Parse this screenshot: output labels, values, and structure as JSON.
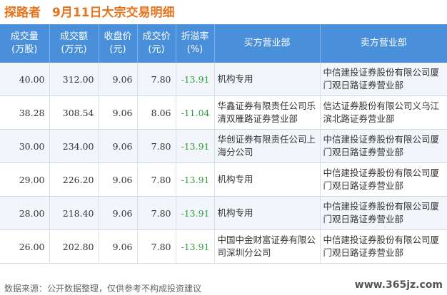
{
  "header": {
    "stock_name": "探路者",
    "title": "9月11日大宗交易明细"
  },
  "table": {
    "columns": [
      {
        "line1": "成交量",
        "line2": "(万股)"
      },
      {
        "line1": "成交额",
        "line2": "(万元)"
      },
      {
        "line1": "收盘价",
        "line2": "(元)"
      },
      {
        "line1": "成交价",
        "line2": "(元)"
      },
      {
        "line1": "折溢率",
        "line2": "(%)"
      },
      {
        "line1": "买方营业部",
        "line2": ""
      },
      {
        "line1": "卖方营业部",
        "line2": ""
      }
    ],
    "rows": [
      {
        "volume": "40.00",
        "amount": "312.00",
        "close": "9.06",
        "price": "7.80",
        "premium": "-13.91",
        "buyer": "机构专用",
        "seller": "中信建投证券股份有限公司厦门观日路证券营业部"
      },
      {
        "volume": "38.28",
        "amount": "308.54",
        "close": "9.06",
        "price": "8.06",
        "premium": "-11.04",
        "buyer": "华鑫证券有限责任公司乐清双雁路证券营业部",
        "seller": "信达证券股份有限公司义乌江滨北路证券营业部"
      },
      {
        "volume": "30.00",
        "amount": "234.00",
        "close": "9.06",
        "price": "7.80",
        "premium": "-13.91",
        "buyer": "华创证券有限责任公司上海分公司",
        "seller": "中信建投证券股份有限公司厦门观日路证券营业部"
      },
      {
        "volume": "29.00",
        "amount": "226.20",
        "close": "9.06",
        "price": "7.80",
        "premium": "-13.91",
        "buyer": "机构专用",
        "seller": "中信建投证券股份有限公司厦门观日路证券营业部"
      },
      {
        "volume": "28.00",
        "amount": "218.40",
        "close": "9.06",
        "price": "7.80",
        "premium": "-13.91",
        "buyer": "机构专用",
        "seller": "中信建投证券股份有限公司厦门观日路证券营业部"
      },
      {
        "volume": "26.00",
        "amount": "202.80",
        "close": "9.06",
        "price": "7.80",
        "premium": "-13.91",
        "buyer": "中国中金财富证券有限公司深圳分公司",
        "seller": "中信建投证券股份有限公司厦门观日路证券营业部"
      }
    ]
  },
  "footer": {
    "source": "数据来源：公开数据整理，仅供参考不构成投资建议",
    "site": "www.365jz.com"
  }
}
